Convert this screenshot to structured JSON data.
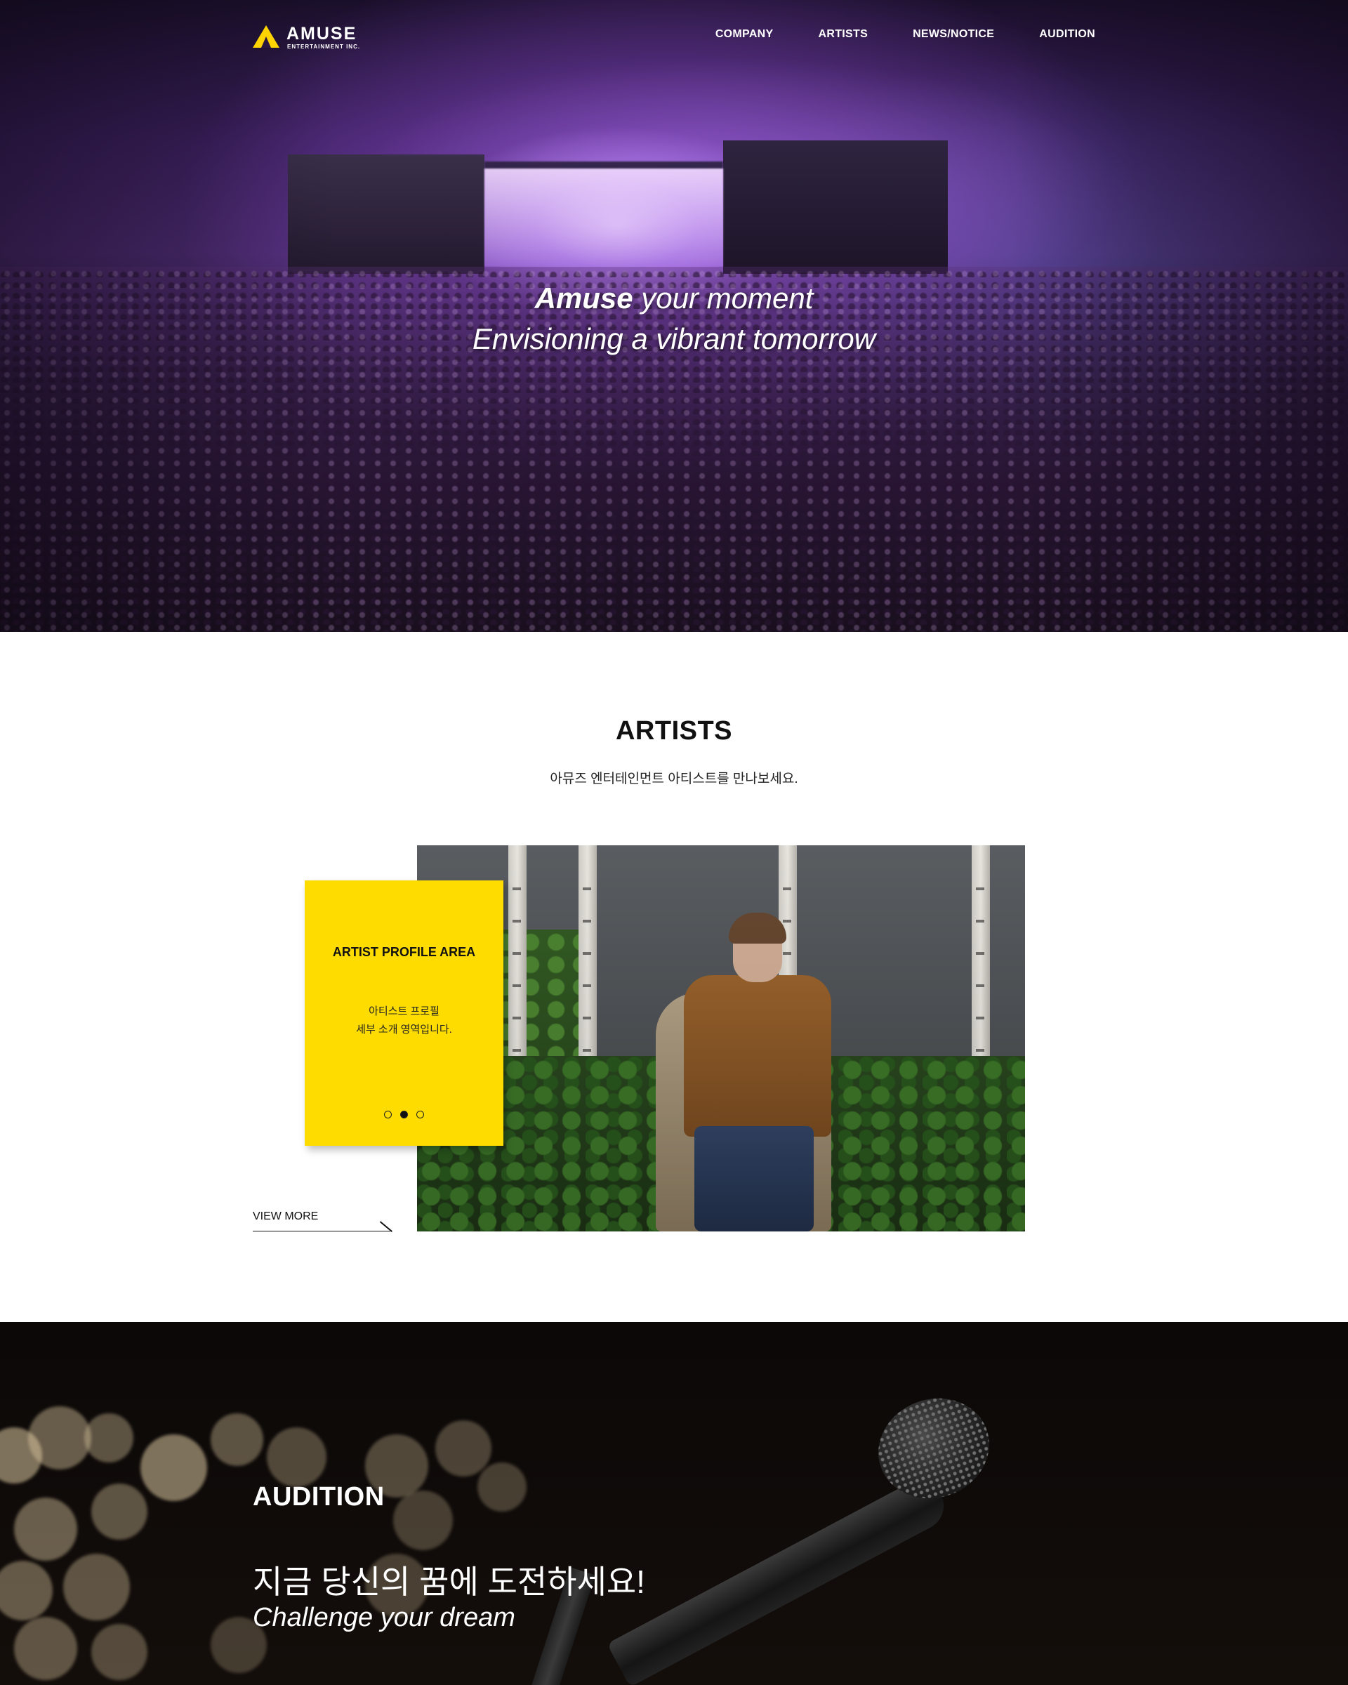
{
  "header": {
    "logo_name": "AMUSE",
    "logo_sub": "ENTERTAINMENT INC.",
    "menu": [
      {
        "label": "COMPANY"
      },
      {
        "label": "ARTISTS"
      },
      {
        "label": "NEWS/NOTICE"
      },
      {
        "label": "AUDITION"
      }
    ]
  },
  "hero": {
    "line1_bold": "Amuse",
    "line1_rest": " your moment",
    "line2": "Envisioning a vibrant tomorrow"
  },
  "artists": {
    "title": "ARTISTS",
    "subtitle": "아뮤즈 엔터테인먼트 아티스트를 만나보세요.",
    "card": {
      "title": "ARTIST PROFILE AREA",
      "desc_line1": "아티스트 프로필",
      "desc_line2": "세부 소개 영역입니다.",
      "slides": 3,
      "active_slide": 2
    },
    "view_more": "VIEW MORE"
  },
  "audition": {
    "title": "AUDITION",
    "headline_ko": "지금 당신의 꿈에 도전하세요!",
    "headline_en": "Challenge your dream"
  },
  "colors": {
    "accent_yellow": "#ffdc00",
    "hero_purple": "#4a2a6e",
    "audition_bg": "#0b0807"
  },
  "icons": [
    "logo-triangle-icon",
    "arrow-right-icon",
    "slider-dot-icon"
  ]
}
